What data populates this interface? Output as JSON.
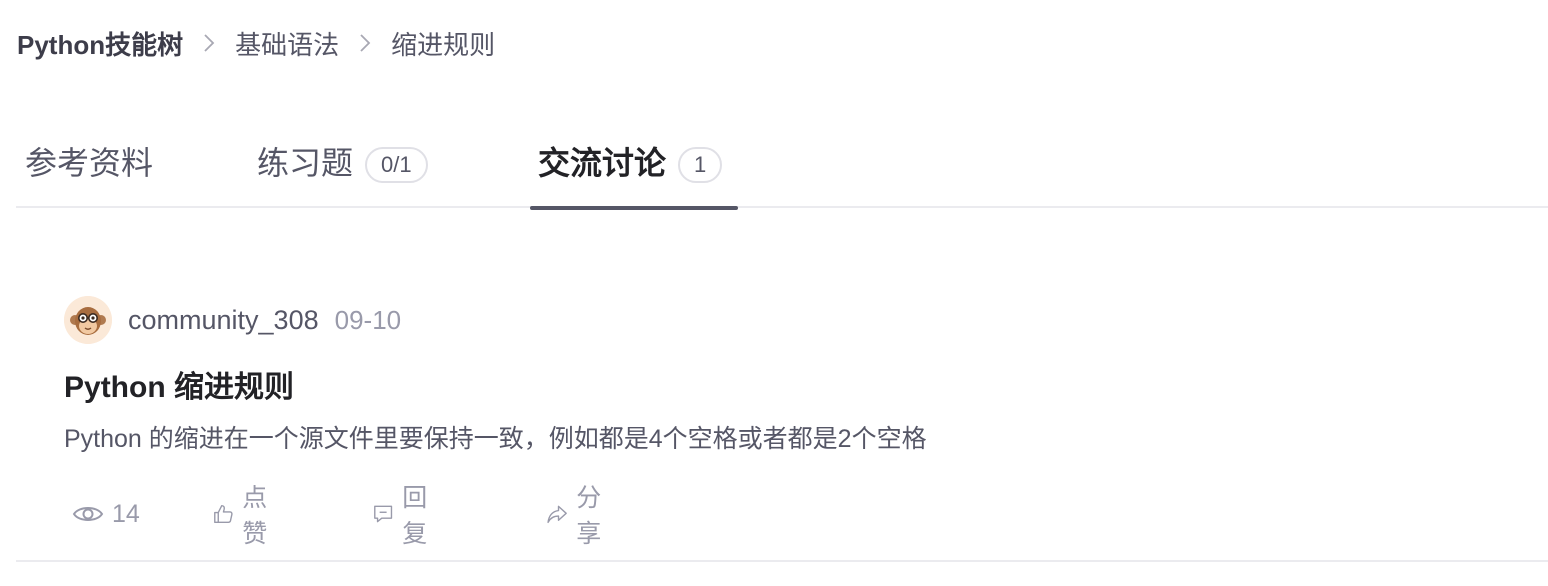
{
  "breadcrumb": {
    "items": [
      "Python技能树",
      "基础语法",
      "缩进规则"
    ]
  },
  "tabs": [
    {
      "label": "参考资料"
    },
    {
      "label": "练习题",
      "badge": "0/1"
    },
    {
      "label": "交流讨论",
      "badge": "1",
      "active": true
    }
  ],
  "post": {
    "author": "community_308",
    "date": "09-10",
    "title": "Python 缩进规则",
    "body": "Python 的缩进在一个源文件里要保持一致，例如都是4个空格或者都是2个空格",
    "actions": {
      "views": "14",
      "like": "点赞",
      "reply": "回复",
      "share": "分享"
    }
  },
  "colors": {
    "text_primary": "#222226",
    "text_secondary": "#555666",
    "text_muted": "#999aaa",
    "divider": "#ebebef"
  },
  "icons": [
    "chevron-right-icon",
    "monkey-avatar-icon",
    "eye-icon",
    "thumbs-up-icon",
    "comment-icon",
    "share-icon"
  ]
}
